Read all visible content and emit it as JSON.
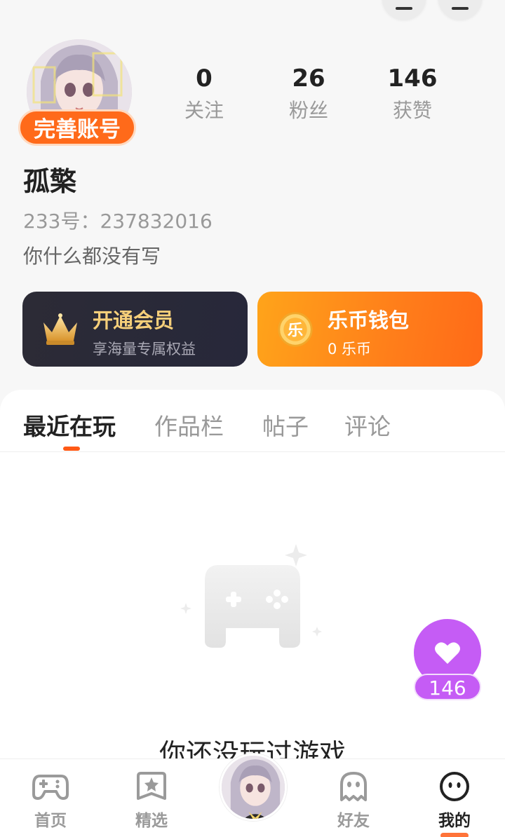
{
  "profile": {
    "badge_label": "完善账号",
    "username": "孤檠",
    "uid": "233号：237832016",
    "bio": "你什么都没有写"
  },
  "stats": [
    {
      "value": "0",
      "label": "关注"
    },
    {
      "value": "26",
      "label": "粉丝"
    },
    {
      "value": "146",
      "label": "获赞"
    }
  ],
  "vip_card": {
    "title": "开通会员",
    "subtitle": "享海量专属权益",
    "icon": "crown-icon"
  },
  "wallet_card": {
    "title": "乐币钱包",
    "subtitle": "0 乐币",
    "icon_char": "乐",
    "icon": "coin-icon"
  },
  "tabs": [
    {
      "label": "最近在玩",
      "active": true
    },
    {
      "label": "作品栏",
      "active": false
    },
    {
      "label": "帖子",
      "active": false
    },
    {
      "label": "评论",
      "active": false
    }
  ],
  "empty_state": {
    "text": "你还没玩过游戏",
    "icon": "gamepad-icon"
  },
  "like_fab": {
    "count": "146",
    "icon": "heart-icon"
  },
  "bottom_nav": [
    {
      "label": "首页",
      "icon": "gamepad-icon",
      "active": false
    },
    {
      "label": "精选",
      "icon": "star-icon",
      "active": false
    },
    {
      "label": "好友",
      "icon": "ghost-icon",
      "active": false
    },
    {
      "label": "我的",
      "icon": "smiley-icon",
      "active": true
    }
  ],
  "colors": {
    "accent": "#ff6a1a",
    "vip_card_bg": "#2c2b36",
    "vip_gold": "#f6cf7a",
    "like_purple": "#c55cf5"
  }
}
